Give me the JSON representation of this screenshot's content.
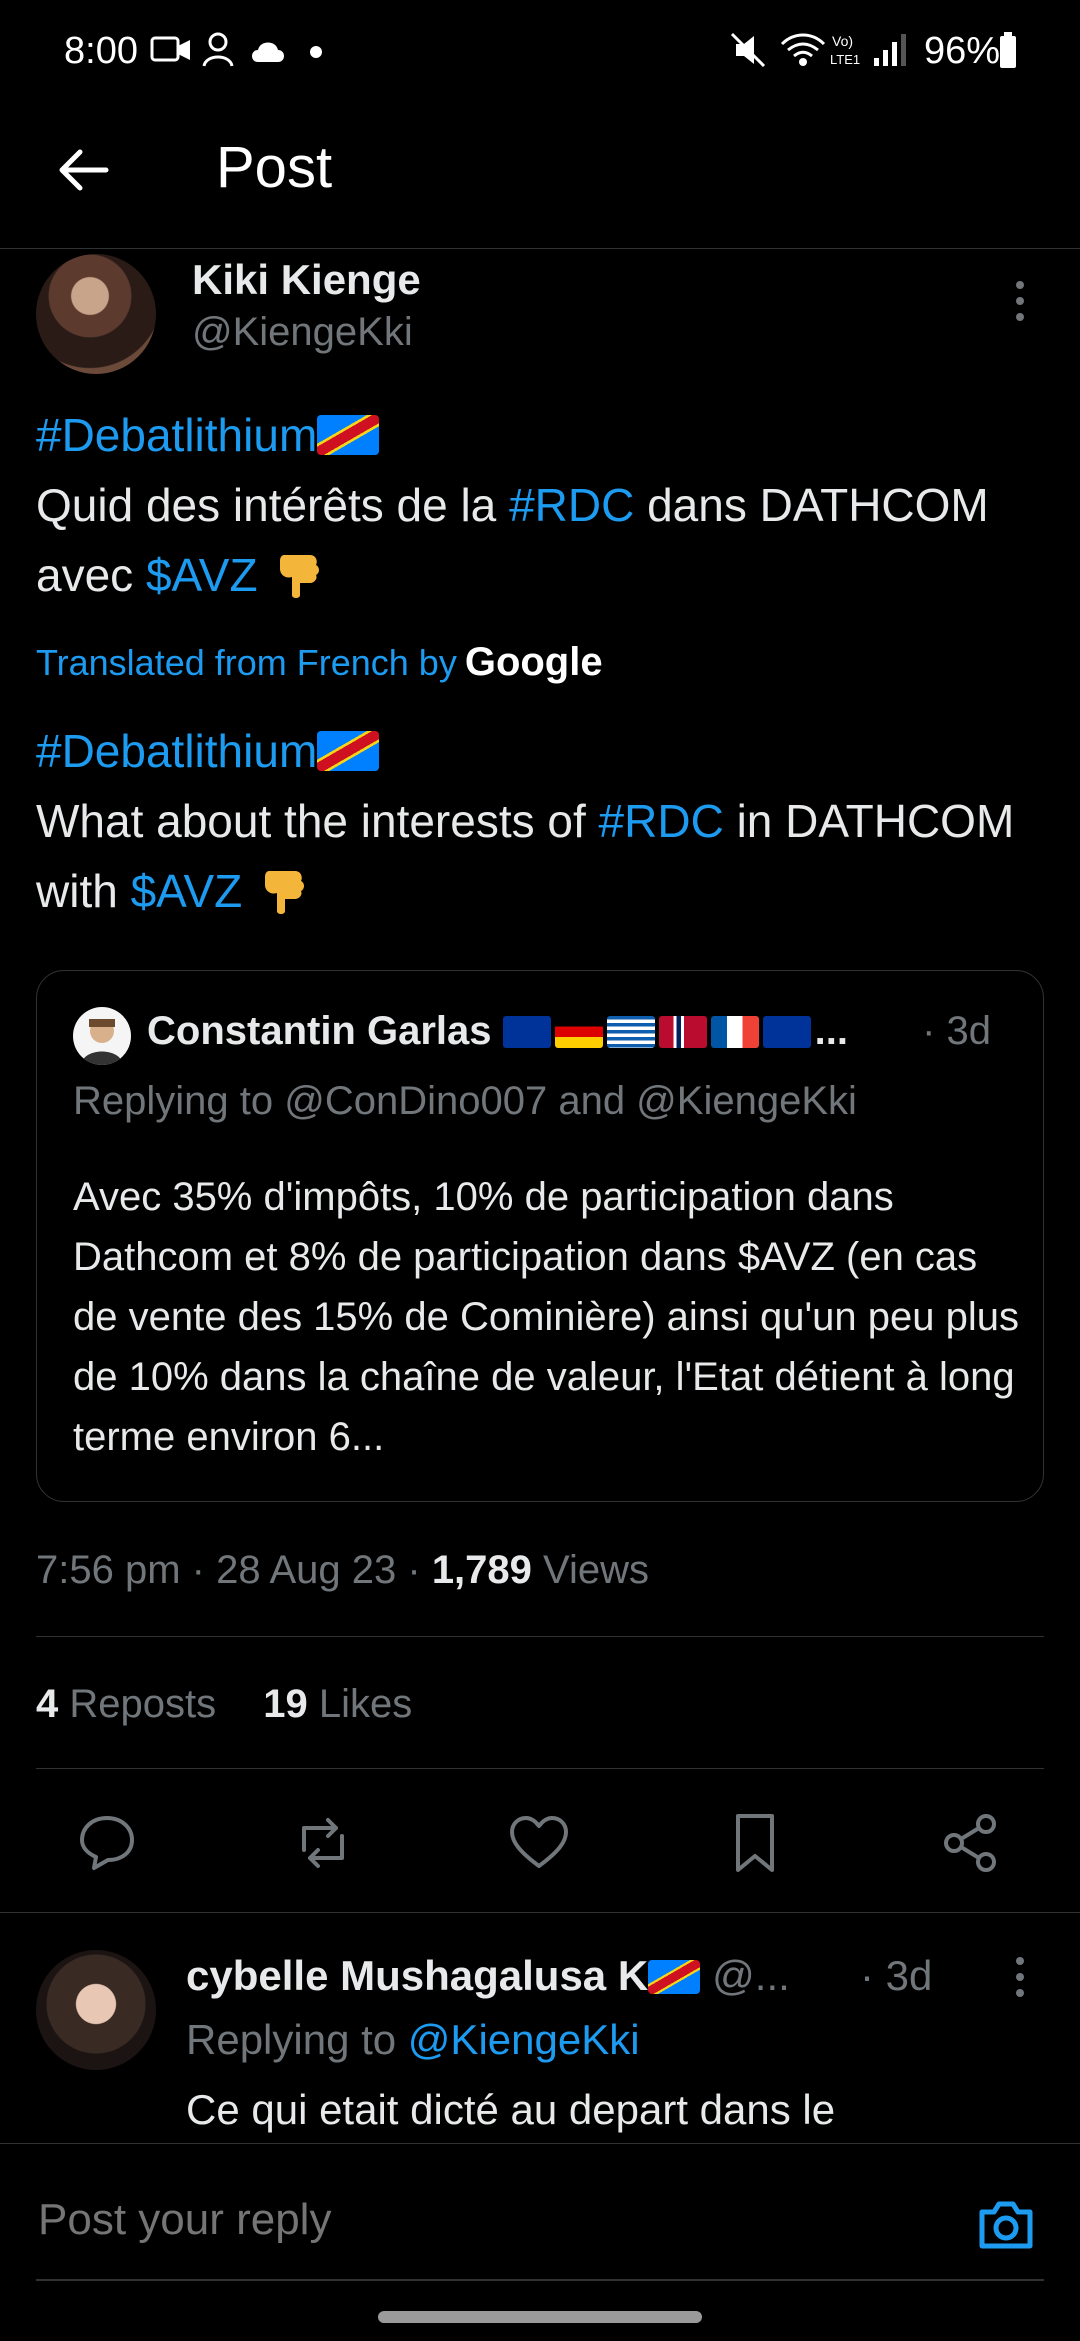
{
  "status_bar": {
    "time": "8:00",
    "battery": "96%"
  },
  "header": {
    "title": "Post"
  },
  "post": {
    "author_name": "Kiki Kienge",
    "author_handle": "@KiengeKki",
    "hashtag": "#Debatlithium",
    "original": {
      "part1": "Quid des intérêts de la ",
      "tag": "#RDC",
      "part2": " dans DATHCOM avec ",
      "cashtag": "$AVZ"
    },
    "translated_label": "Translated from French by",
    "translated_brand": "Google",
    "translated": {
      "part1": "What about the interests of ",
      "tag": "#RDC",
      "part2": " in DATHCOM with ",
      "cashtag": "$AVZ"
    },
    "timestamp": "7:56 pm · 28 Aug 23 · ",
    "views_count": "1,789",
    "views_label": " Views",
    "reposts_count": "4",
    "reposts_label": " Reposts",
    "likes_count": "19",
    "likes_label": " Likes"
  },
  "quote": {
    "name": "Constantin Garlas",
    "ellipsis": "...",
    "time": "· 3d",
    "replying": "Replying to @ConDino007 and @KiengeKki",
    "text": "Avec 35% d'impôts, 10% de participation dans Dathcom et 8% de participation dans $AVZ (en cas de vente des 15% de Cominière) ainsi qu'un peu plus de 10% dans la chaîne de valeur, l'Etat détient à long terme environ 6..."
  },
  "reply": {
    "name": "cybelle Mushagalusa K",
    "handle": "@...",
    "time": "· 3d",
    "replying_prefix": "Replying to ",
    "replying_handle": "@KiengeKki",
    "text": "Ce qui etait dicté au depart dans le"
  },
  "composer": {
    "placeholder": "Post your reply"
  },
  "colors": {
    "accent": "#1d9bf0",
    "background": "#000000",
    "muted": "#71767b",
    "border": "#2f3336"
  }
}
